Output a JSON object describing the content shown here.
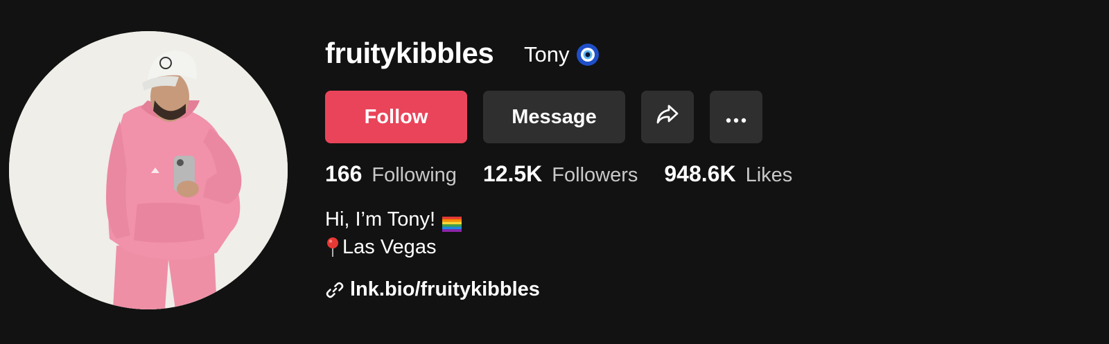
{
  "profile": {
    "username": "fruitykibbles",
    "nickname": "Tony",
    "nickname_icon": "nazar-amulet-icon",
    "avatar_icon": "profile-photo"
  },
  "actions": {
    "follow_label": "Follow",
    "message_label": "Message",
    "share_icon": "share-arrow-icon",
    "more_icon": "more-dots-icon"
  },
  "stats": {
    "following": {
      "count": "166",
      "label": "Following"
    },
    "followers": {
      "count": "12.5K",
      "label": "Followers"
    },
    "likes": {
      "count": "948.6K",
      "label": "Likes"
    }
  },
  "bio": {
    "line1": "Hi, I’m Tony!",
    "line1_icon": "rainbow-flag-icon",
    "line2": "Las Vegas",
    "line2_icon": "pin-icon"
  },
  "link": {
    "text": "lnk.bio/fruitykibbles",
    "icon": "link-icon"
  },
  "colors": {
    "background": "#121212",
    "follow_button": "#ea445a",
    "secondary_button": "#2f2f2f",
    "muted_text": "#c9c9c9"
  }
}
